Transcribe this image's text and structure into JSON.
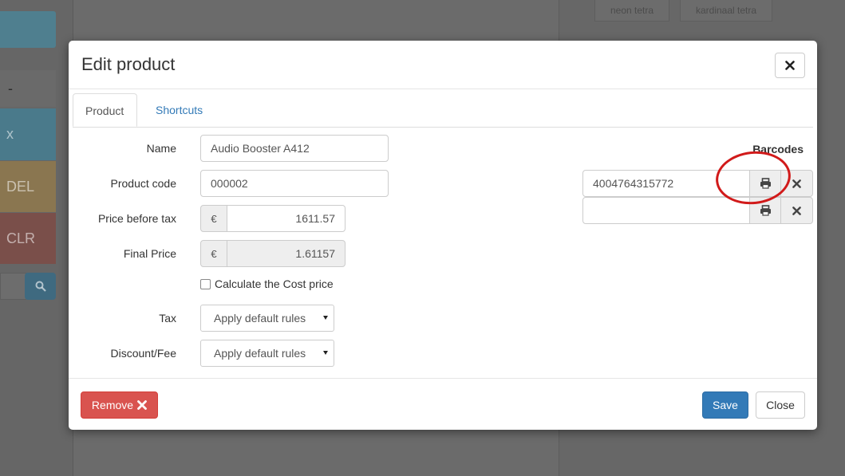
{
  "background": {
    "keys": [
      "x",
      "DEL",
      "CLR"
    ],
    "minus_key": "-",
    "product_chips": [
      "neon tetra",
      "kardinaal tetra"
    ]
  },
  "modal": {
    "title": "Edit product",
    "tabs": [
      {
        "label": "Product",
        "active": true
      },
      {
        "label": "Shortcuts",
        "active": false
      }
    ],
    "form": {
      "name_label": "Name",
      "name_value": "Audio Booster A412",
      "code_label": "Product code",
      "code_value": "000002",
      "price_label": "Price before tax",
      "currency_symbol": "€",
      "price_value": "1611.57",
      "final_label": "Final Price",
      "final_value": "1.61157",
      "calc_cost_label": "Calculate the Cost price",
      "calc_cost_checked": false,
      "tax_label": "Tax",
      "tax_value": "Apply default rules",
      "discount_label": "Discount/Fee",
      "discount_value": "Apply default rules"
    },
    "barcodes": {
      "title": "Barcodes",
      "rows": [
        {
          "value": "4004764315772"
        },
        {
          "value": ""
        }
      ]
    },
    "footer": {
      "remove_label": "Remove",
      "save_label": "Save",
      "close_label": "Close"
    }
  },
  "colors": {
    "primary": "#337ab7",
    "danger": "#d9534f",
    "annotation": "#d11a1a"
  }
}
